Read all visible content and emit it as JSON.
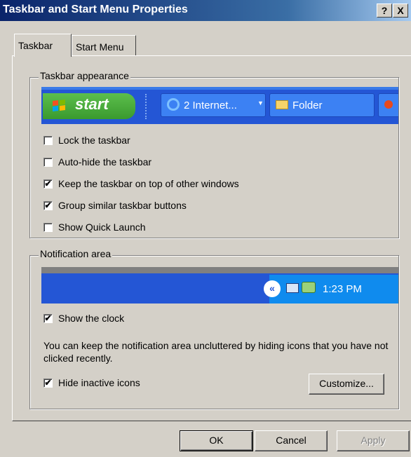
{
  "window": {
    "title": "Taskbar and Start Menu Properties",
    "help_label": "?",
    "close_label": "X"
  },
  "tabs": [
    {
      "label": "Taskbar",
      "active": true
    },
    {
      "label": "Start Menu",
      "active": false
    }
  ],
  "taskbar_appearance": {
    "group_label": "Taskbar appearance",
    "preview": {
      "start_label": "start",
      "item1_label": "2 Internet...",
      "item2_label": "Folder"
    },
    "options": [
      {
        "label": "Lock the taskbar",
        "checked": false
      },
      {
        "label": "Auto-hide the taskbar",
        "checked": false
      },
      {
        "label": "Keep the taskbar on top of other windows",
        "checked": true
      },
      {
        "label": "Group similar taskbar buttons",
        "checked": true
      },
      {
        "label": "Show Quick Launch",
        "checked": false
      }
    ]
  },
  "notification_area": {
    "group_label": "Notification area",
    "preview": {
      "clock": "1:23 PM"
    },
    "show_clock": {
      "label": "Show the clock",
      "checked": true
    },
    "description": "You can keep the notification area uncluttered by hiding icons that you have not clicked recently.",
    "hide_inactive": {
      "label": "Hide inactive icons",
      "checked": true
    },
    "customize_label": "Customize..."
  },
  "buttons": {
    "ok": "OK",
    "cancel": "Cancel",
    "apply": "Apply"
  },
  "colors": {
    "title_bar": "#0a246a",
    "taskbar_blue": "#2456d5",
    "start_green": "#3a9a2e",
    "dialog_face": "#d4d0c8"
  }
}
